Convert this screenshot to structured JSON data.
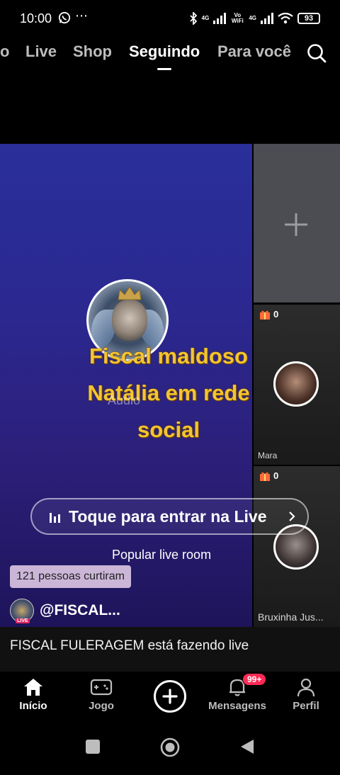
{
  "status_bar": {
    "time": "10:00",
    "dots": "⋯",
    "network_1": "4G",
    "volte": "Vo WiFi",
    "network_2": "4G",
    "battery": "93"
  },
  "top_nav": {
    "tabs": [
      {
        "label": "o",
        "active": false
      },
      {
        "label": "Live",
        "active": false
      },
      {
        "label": "Shop",
        "active": false
      },
      {
        "label": "Seguindo",
        "active": true
      },
      {
        "label": "Para você",
        "active": false
      }
    ],
    "search_icon": "search-icon"
  },
  "live_card": {
    "title": "Fiscal maldoso Natália em rede social",
    "audio_label": "Áudio",
    "enter_button": "Toque para entrar na Live",
    "popular_label": "Popular live room",
    "likes": "121 pessoas curtiram",
    "host_handle": "@FISCAL...",
    "live_tag": "LIVE"
  },
  "side_rail": {
    "add_icon": "plus-icon",
    "cards": [
      {
        "gifts": "0",
        "name": "Mara"
      },
      {
        "gifts": "0",
        "name": "Bruxinha Jus..."
      }
    ]
  },
  "live_status": "FISCAL FULERAGEM está fazendo live",
  "bottom_nav": {
    "items": [
      {
        "label": "Início",
        "icon": "home-icon",
        "active": true
      },
      {
        "label": "Jogo",
        "icon": "gamepad-icon",
        "active": false
      },
      {
        "label": "",
        "icon": "create-plus-icon",
        "active": false
      },
      {
        "label": "Mensagens",
        "icon": "bell-icon",
        "active": false,
        "badge": "99+"
      },
      {
        "label": "Perfil",
        "icon": "person-icon",
        "active": false
      }
    ]
  },
  "colors": {
    "title_yellow": "#f5c430",
    "badge_red": "#ff2a55",
    "card_blue": "#2a2f9a"
  }
}
